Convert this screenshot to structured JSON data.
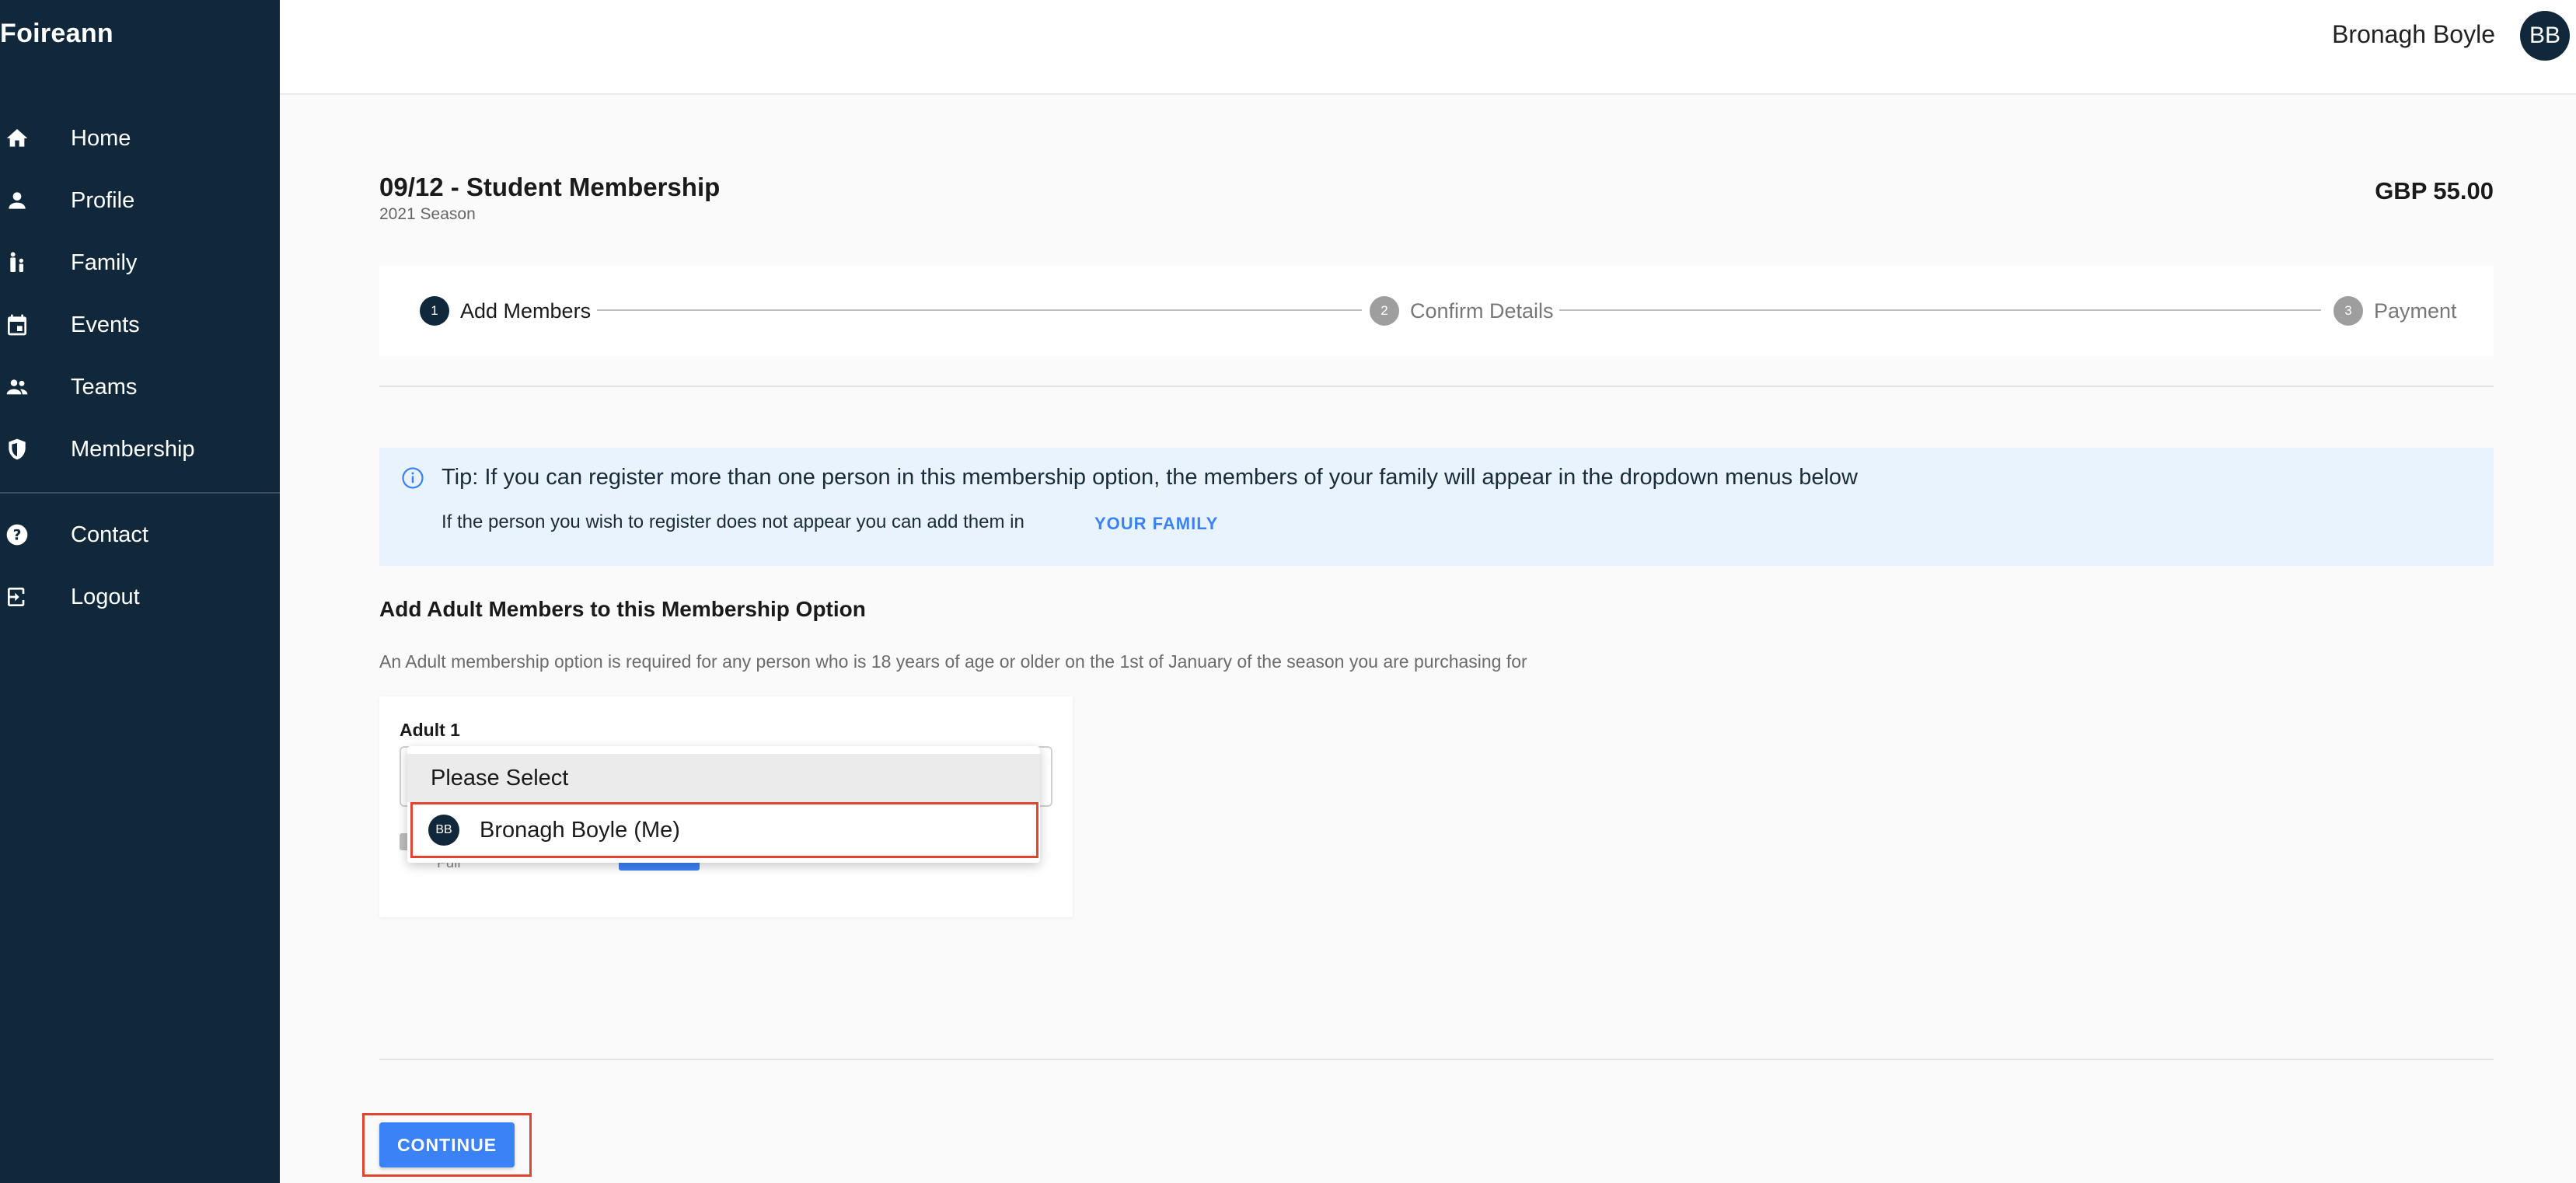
{
  "app": {
    "brand": "Foireann"
  },
  "sidebar": {
    "items": [
      {
        "label": "Home",
        "icon": "home-icon"
      },
      {
        "label": "Profile",
        "icon": "person-icon"
      },
      {
        "label": "Family",
        "icon": "family-icon"
      },
      {
        "label": "Events",
        "icon": "calendar-icon"
      },
      {
        "label": "Teams",
        "icon": "group-icon"
      },
      {
        "label": "Membership",
        "icon": "shield-icon"
      },
      {
        "label": "Contact",
        "icon": "help-icon"
      },
      {
        "label": "Logout",
        "icon": "logout-icon"
      }
    ]
  },
  "user": {
    "name": "Bronagh Boyle",
    "initials": "BB"
  },
  "header": {
    "title": "09/12 - Student Membership",
    "subtitle": "2021 Season",
    "price": "GBP 55.00"
  },
  "stepper": {
    "steps": [
      {
        "number": "1",
        "label": "Add Members",
        "active": true
      },
      {
        "number": "2",
        "label": "Confirm Details",
        "active": false
      },
      {
        "number": "3",
        "label": "Payment",
        "active": false
      }
    ]
  },
  "tip": {
    "line1": "Tip: If you can register more than one person in this membership option, the members of your family will appear in the dropdown menus below",
    "line2": "If the person you wish to register does not appear you can add them in",
    "link": "YOUR FAMILY"
  },
  "section": {
    "title": "Add Adult Members to this Membership Option",
    "description": "An Adult membership option is required for any person who is 18 years of age or older on the 1st of January of the season you are purchasing for"
  },
  "adult_card": {
    "label": "Adult 1",
    "hidden_text": "Full",
    "dropdown": {
      "placeholder": "Please Select",
      "options": [
        {
          "initials": "BB",
          "label": "Bronagh Boyle (Me)"
        }
      ]
    }
  },
  "footer": {
    "continue_label": "CONTINUE"
  },
  "colors": {
    "sidebar_bg": "#11283b",
    "accent": "#3b82f6",
    "tip_bg": "#e8f3fd",
    "highlight": "#e2452f"
  }
}
